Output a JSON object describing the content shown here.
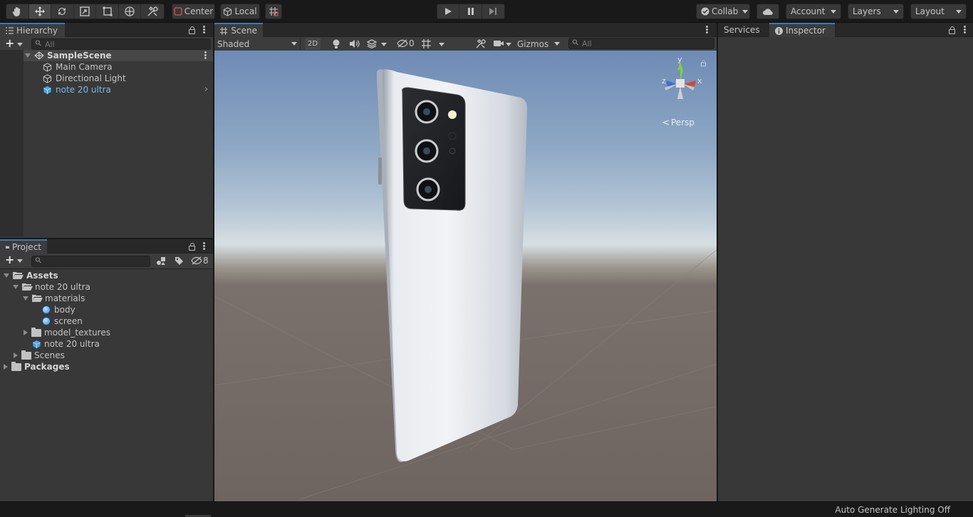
{
  "toolbar": {
    "pivot": "Center",
    "space": "Local",
    "collab": "Collab",
    "account": "Account",
    "layers": "Layers",
    "layout": "Layout"
  },
  "hierarchy": {
    "tab": "Hierarchy",
    "search_placeholder": "All",
    "scene": "SampleScene",
    "items": [
      {
        "label": "Main Camera"
      },
      {
        "label": "Directional Light"
      },
      {
        "label": "note 20 ultra"
      }
    ]
  },
  "scene_view": {
    "tab": "Scene",
    "shading": "Shaded",
    "mode_2d": "2D",
    "hidden_count": "0",
    "gizmos": "Gizmos",
    "search_placeholder": "All",
    "projection": "Persp",
    "axis_y": "y",
    "axis_x": "x",
    "axis_z": "z"
  },
  "right_panel": {
    "tab_services": "Services",
    "tab_inspector": "Inspector"
  },
  "project": {
    "tab": "Project",
    "hidden_count": "8",
    "tree": [
      {
        "label": "Assets"
      },
      {
        "label": "note 20 ultra"
      },
      {
        "label": "materials"
      },
      {
        "label": "body"
      },
      {
        "label": "screen"
      },
      {
        "label": "model_textures"
      },
      {
        "label": "note 20 ultra"
      },
      {
        "label": "Scenes"
      },
      {
        "label": "Packages"
      }
    ]
  },
  "status": {
    "text": "Auto Generate Lighting Off"
  },
  "colors": {
    "accent": "#3a79bb",
    "selection_text": "#7fb4ea",
    "panel": "#383838"
  }
}
